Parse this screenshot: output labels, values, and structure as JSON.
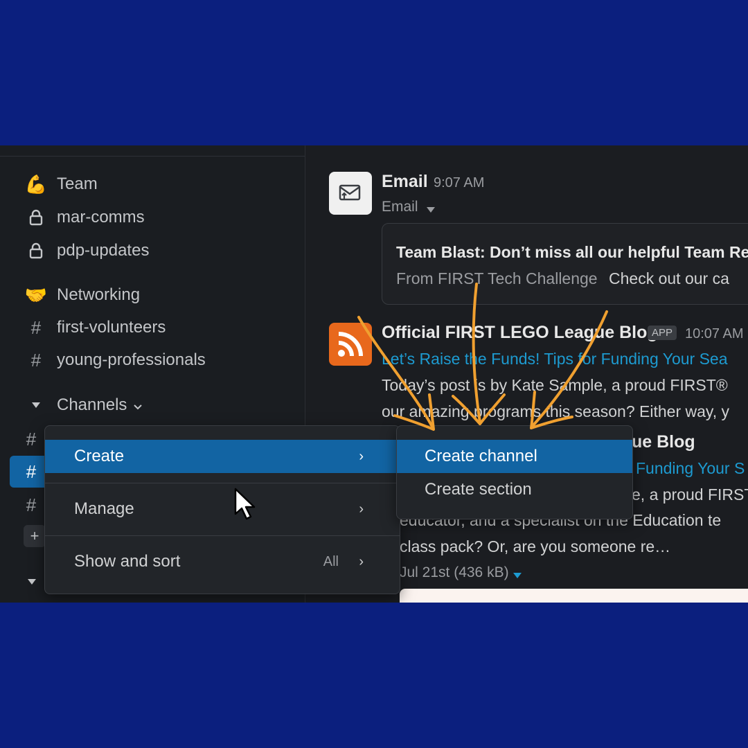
{
  "sidebar": {
    "items": [
      {
        "icon": "flexed-biceps-icon",
        "glyph": "💪",
        "label": "Team"
      },
      {
        "icon": "lock-icon",
        "glyph": "🔒",
        "label": "mar-comms"
      },
      {
        "icon": "lock-icon",
        "glyph": "🔒",
        "label": "pdp-updates"
      },
      {
        "icon": "handshake-icon",
        "glyph": "🤝",
        "label": "Networking"
      },
      {
        "icon": "hash-icon",
        "glyph": "#",
        "label": "first-volunteers"
      },
      {
        "icon": "hash-icon",
        "glyph": "#",
        "label": "young-professionals"
      }
    ],
    "section_label": "Channels",
    "hash_glyph": "#",
    "add_glyph": "+"
  },
  "messages": {
    "email": {
      "sender": "Email",
      "time": "9:07 AM",
      "sub": "Email",
      "subject": "Team Blast: Don’t miss all our helpful Team Re",
      "from_label": "From FIRST Tech Challenge",
      "from_text": "Check out our ca"
    },
    "blog": {
      "sender": "Official FIRST LEGO League Blog",
      "badge": "APP",
      "time": "10:07 AM",
      "link": "Let’s Raise the Funds! Tips for Funding Your Sea",
      "body1": "Today’s post is by Kate Sample, a proud FIRST®",
      "body2": "our amazing programs this season? Either way, y",
      "sender2_fragment": "ue Blog",
      "link2_fragment": "Funding Your S",
      "body3_fragment": "e, a proud FIRST",
      "body4": "educator, and a specialist on the Education te",
      "body5": "class pack? Or, are you someone re…",
      "meta": "Jul 21st (436 kB)"
    }
  },
  "menu": {
    "items": [
      {
        "label": "Create",
        "chevron": "›",
        "extra": ""
      },
      {
        "label": "Manage",
        "chevron": "›",
        "extra": ""
      },
      {
        "label": "Show and sort",
        "chevron": "›",
        "extra": "All"
      }
    ]
  },
  "submenu": {
    "items": [
      {
        "label": "Create channel"
      },
      {
        "label": "Create section"
      }
    ]
  },
  "colors": {
    "frame": "#0b1f7e",
    "highlight": "#1264a3",
    "link": "#1d9bd1",
    "arrows": "#f0a030"
  }
}
